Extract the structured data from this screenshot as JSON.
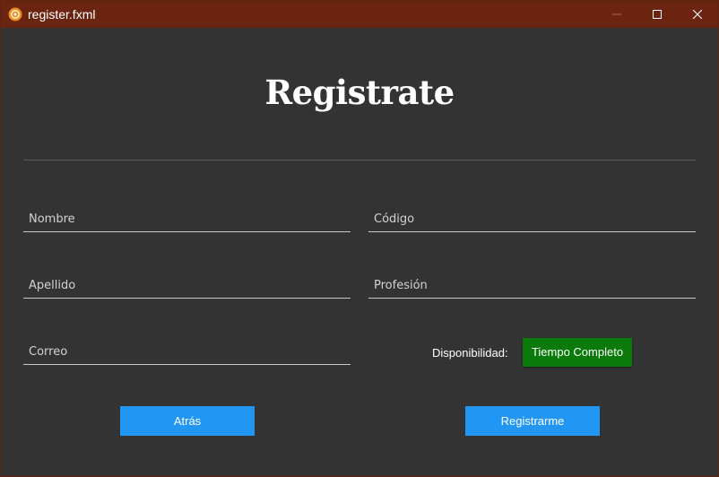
{
  "window": {
    "title": "register.fxml",
    "app_icon": "gear-badge-icon",
    "controls": [
      "minimize-icon",
      "maximize-icon",
      "close-icon"
    ],
    "colors": {
      "titlebar": "#6b2410",
      "background": "#333333"
    }
  },
  "form": {
    "heading": "Registrate",
    "fields": {
      "nombre": {
        "placeholder": "Nombre",
        "value": ""
      },
      "codigo": {
        "placeholder": "Código",
        "value": ""
      },
      "apellido": {
        "placeholder": "Apellido",
        "value": ""
      },
      "profesion": {
        "placeholder": "Profesión",
        "value": ""
      },
      "correo": {
        "placeholder": "Correo",
        "value": ""
      }
    },
    "availability": {
      "label": "Disponibilidad:",
      "selected": "Tiempo Completo",
      "color": "#0a7a0a"
    },
    "buttons": {
      "back": "Atrás",
      "register": "Registrarme",
      "color": "#2196f3"
    }
  }
}
